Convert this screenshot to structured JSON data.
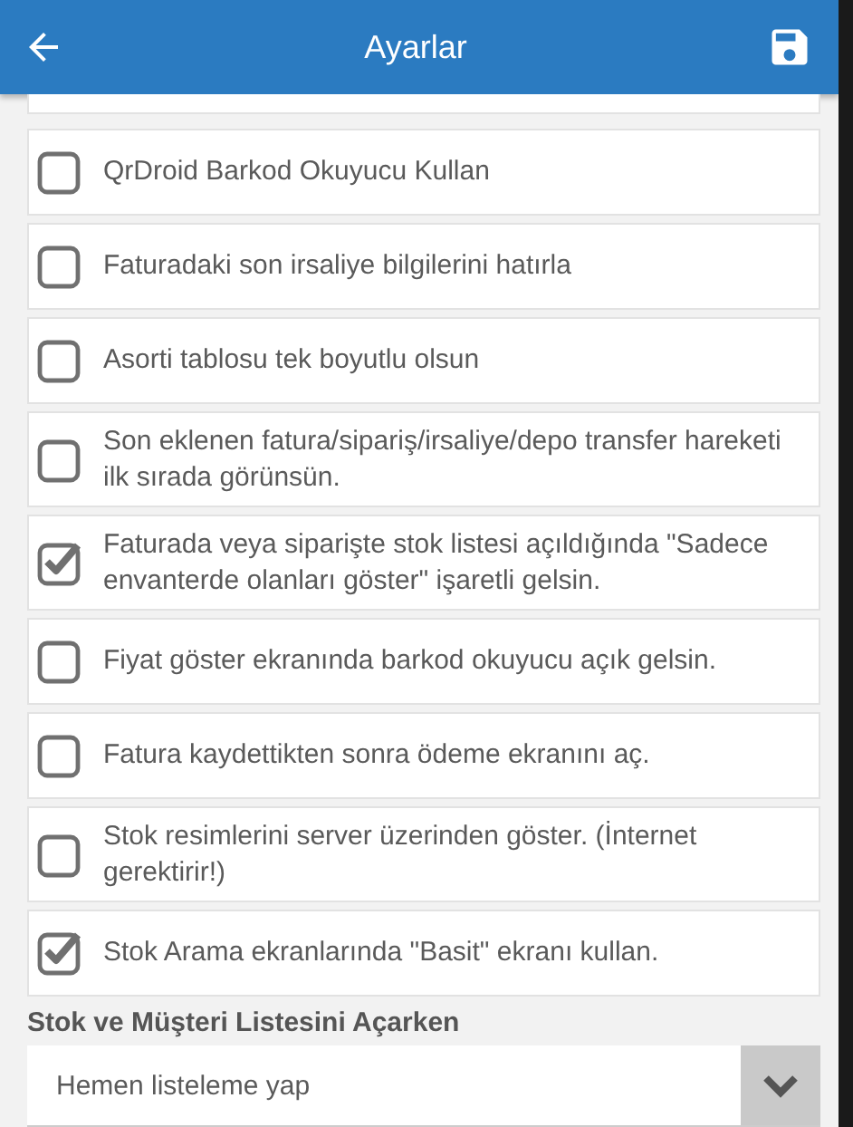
{
  "app_bar": {
    "title": "Ayarlar"
  },
  "settings": [
    {
      "label": "QrDroid Barkod Okuyucu Kullan",
      "checked": false
    },
    {
      "label": "Faturadaki son irsaliye bilgilerini hatırla",
      "checked": false
    },
    {
      "label": "Asorti tablosu tek boyutlu olsun",
      "checked": false
    },
    {
      "label": "Son eklenen fatura/sipariş/irsaliye/depo transfer hareketi ilk sırada görünsün.",
      "checked": false
    },
    {
      "label": "Faturada veya siparişte stok listesi açıldığında \"Sadece envanterde olanları göster\" işaretli gelsin.",
      "checked": true
    },
    {
      "label": "Fiyat göster ekranında barkod okuyucu açık gelsin.",
      "checked": false
    },
    {
      "label": "Fatura kaydettikten sonra ödeme ekranını aç.",
      "checked": false
    },
    {
      "label": "Stok resimlerini server üzerinden göster. (İnternet gerektirir!)",
      "checked": false
    },
    {
      "label": "Stok Arama ekranlarında \"Basit\" ekranı kullan.",
      "checked": true
    }
  ],
  "list_open": {
    "label": "Stok ve Müşteri Listesini Açarken",
    "value": "Hemen listeleme yap"
  }
}
